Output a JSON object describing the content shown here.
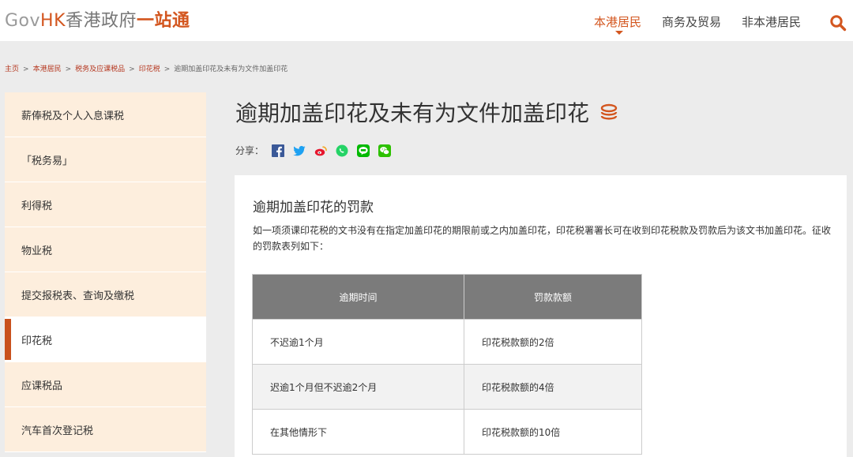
{
  "logo": {
    "gov": "Gov",
    "hk": "HK",
    "cn": "香港政府",
    "one": "一站通"
  },
  "nav": {
    "items": [
      {
        "label": "本港居民"
      },
      {
        "label": "商务及贸易"
      },
      {
        "label": "非本港居民"
      }
    ],
    "active_index": 0
  },
  "breadcrumb": {
    "items": [
      {
        "label": "主页"
      },
      {
        "label": "本港居民"
      },
      {
        "label": "税务及应课税品"
      },
      {
        "label": "印花税"
      },
      {
        "label": "逾期加盖印花及未有为文件加盖印花"
      }
    ],
    "separator": ">"
  },
  "sidebar": {
    "items": [
      {
        "label": "薪俸税及个人入息课税"
      },
      {
        "label": "「税务易」"
      },
      {
        "label": "利得税"
      },
      {
        "label": "物业税"
      },
      {
        "label": "提交报税表、查询及缴税"
      },
      {
        "label": "印花税"
      },
      {
        "label": "应课税品"
      },
      {
        "label": "汽车首次登记税"
      }
    ],
    "active_index": 5
  },
  "page": {
    "title": "逾期加盖印花及未有为文件加盖印花",
    "share_label": "分享：",
    "share_icons": [
      "facebook-icon",
      "twitter-icon",
      "weibo-icon",
      "whatsapp-icon",
      "line-icon",
      "wechat-icon"
    ]
  },
  "content": {
    "section_title": "逾期加盖印花的罚款",
    "paragraph": "如一项须课印花税的文书没有在指定加盖印花的期限前或之内加盖印花，印花税署署长可在收到印花税款及罚款后为该文书加盖印花。征收的罚款表列如下：",
    "table": {
      "headers": [
        "逾期时间",
        "罚款款额"
      ],
      "rows": [
        [
          "不迟逾1个月",
          "印花税款额的2倍"
        ],
        [
          "迟逾1个月但不迟逾2个月",
          "印花税款额的4倍"
        ],
        [
          "在其他情形下",
          "印花税款额的10倍"
        ]
      ]
    }
  },
  "colors": {
    "brand": "#d3561f",
    "sidebar_bg": "#fdeedd",
    "table_header": "#7b7b7b"
  }
}
